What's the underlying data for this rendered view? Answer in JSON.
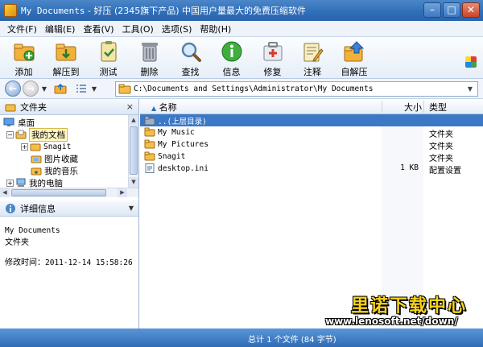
{
  "window": {
    "title_path": "My Documents",
    "title_rest": " - 好压 (2345旗下产品) 中国用户量最大的免费压缩软件",
    "min": "–",
    "max": "□",
    "close": "✕"
  },
  "menu": [
    "文件(F)",
    "编辑(E)",
    "查看(V)",
    "工具(O)",
    "选项(S)",
    "帮助(H)"
  ],
  "toolbar": {
    "items": [
      {
        "label": "添加",
        "icon": "add-archive-icon"
      },
      {
        "label": "解压到",
        "icon": "extract-to-icon"
      },
      {
        "label": "测试",
        "icon": "test-icon"
      },
      {
        "label": "删除",
        "icon": "delete-icon"
      },
      {
        "label": "查找",
        "icon": "find-icon"
      },
      {
        "label": "信息",
        "icon": "info-icon"
      },
      {
        "label": "修复",
        "icon": "repair-icon"
      },
      {
        "label": "注释",
        "icon": "comment-icon"
      },
      {
        "label": "自解压",
        "icon": "self-extract-icon"
      }
    ]
  },
  "address": {
    "path": "C:\\Documents and Settings\\Administrator\\My Documents"
  },
  "left_pane": {
    "header": "文件夹",
    "close": "×",
    "tree": [
      {
        "label": "桌面",
        "level": 0,
        "exp": ""
      },
      {
        "label": "我的文档",
        "level": 1,
        "exp": "−",
        "selected": true
      },
      {
        "label": "Snagit",
        "level": 2,
        "exp": "+"
      },
      {
        "label": "图片收藏",
        "level": 2,
        "exp": ""
      },
      {
        "label": "我的音乐",
        "level": 2,
        "exp": ""
      },
      {
        "label": "我的电脑",
        "level": 1,
        "exp": "+"
      }
    ]
  },
  "details": {
    "header": "详细信息",
    "name": "My Documents",
    "kind": "文件夹",
    "modified_label": "修改时间：",
    "modified_value": "2011-12-14 15:58:26"
  },
  "file_list": {
    "columns": {
      "name": "名称",
      "size": "大小",
      "type": "类型"
    },
    "rows": [
      {
        "name": "..(上层目录)",
        "size": "",
        "type": "",
        "icon": "folder-up-icon",
        "selected": true
      },
      {
        "name": "My Music",
        "size": "",
        "type": "文件夹",
        "icon": "folder-icon"
      },
      {
        "name": "My Pictures",
        "size": "",
        "type": "文件夹",
        "icon": "folder-icon"
      },
      {
        "name": "Snagit",
        "size": "",
        "type": "文件夹",
        "icon": "folder-icon"
      },
      {
        "name": "desktop.ini",
        "size": "1 KB",
        "type": "配置设置",
        "icon": "ini-file-icon"
      }
    ]
  },
  "status": {
    "text": "总计 1 个文件 (84 字节)"
  },
  "watermark": {
    "cn": "里诺下载中心",
    "url": "www.lenosoft.net/down/"
  }
}
